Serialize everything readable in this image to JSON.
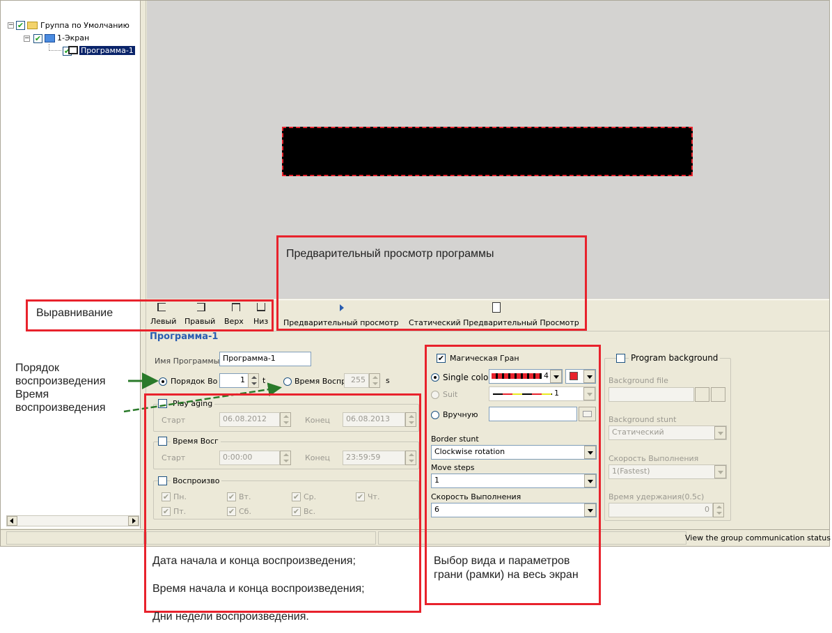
{
  "tree": {
    "group": "Группа по Умолчанию",
    "screen": "1-Экран",
    "program": "Программа-1"
  },
  "preview": {
    "caption": "Предварительный просмотр программы"
  },
  "alignment": {
    "label": "Выравнивание",
    "left": "Левый",
    "right": "Правый",
    "top": "Верх",
    "bottom": "Низ"
  },
  "toolbar": {
    "preview": "Предварительный просмотр",
    "static_preview": "Статический Предварительный Просмотр"
  },
  "program": {
    "title": "Программа-1",
    "name_label": "Имя Программы",
    "name_value": "Программа-1",
    "order_label": "Порядок Во",
    "order_value": "1",
    "order_unit": "t",
    "time_label": "Время Воспр",
    "time_value": "255",
    "time_unit": "s"
  },
  "aging": {
    "title": "Play aging",
    "start_label": "Старт",
    "start_value": "06.08.2012",
    "end_label": "Конец",
    "end_value": "06.08.2013"
  },
  "timeplay": {
    "title": "Время Восг",
    "start_label": "Старт",
    "start_value": "0:00:00",
    "end_label": "Конец",
    "end_value": "23:59:59"
  },
  "days": {
    "title": "Воспроизво",
    "mon": "Пн.",
    "tue": "Вт.",
    "wed": "Ср.",
    "thu": "Чт.",
    "fri": "Пт.",
    "sat": "Сб.",
    "sun": "Вс."
  },
  "border": {
    "title": "Магическая Гран",
    "single": "Single color",
    "single_value": "4",
    "suit": "Suit",
    "suit_value": "1",
    "manual": "Вручную",
    "stunt_label": "Border stunt",
    "stunt_value": "Clockwise rotation",
    "steps_label": "Move steps",
    "steps_value": "1",
    "speed_label": "Скорость Выполнения",
    "speed_value": "6"
  },
  "background": {
    "title": "Program background",
    "file_label": "Background file",
    "stunt_label": "Background stunt",
    "stunt_value": "Статический",
    "speed_label": "Скорость Выполнения",
    "speed_value": "1(Fastest)",
    "hold_label": "Время удержания(0.5с)",
    "hold_value": "0"
  },
  "status": {
    "right": "View the group communication status"
  },
  "notes": {
    "order1": "Порядок",
    "order2": "воспроизведения",
    "time1": "Время",
    "time2": "воспроизведения",
    "dates": "Дата начала и конца воспроизведения;",
    "times": "Время начала и конца воспроизведения;",
    "weekdays": "Дни недели воспроизведения.",
    "border1": "Выбор вида и параметров",
    "border2": "грани (рамки) на весь экран"
  },
  "colors": {
    "accent": "#e8222c",
    "arrow": "#2a7a2a",
    "title_blue": "#2a5db0"
  }
}
